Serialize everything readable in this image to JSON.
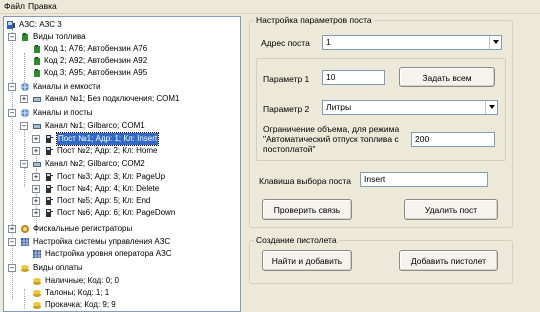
{
  "menu": {
    "file": "Файл",
    "edit": "Правка"
  },
  "tree": {
    "root": "АЗС: АЗС 3",
    "fuel_types": "Виды топлива",
    "fuel_items": [
      "Код 1; А76; Автобензин А76",
      "Код 2; А92; Автобензин А92",
      "Код 3; А95; Автобензин А95"
    ],
    "channels_tanks": "Каналы и емкости",
    "channel_1": "Канал №1; Без подключения; COM1",
    "channels_posts": "Каналы и посты",
    "channel_gilbarco_1": "Канал №1; Gilbarco; COM1",
    "posts_1": [
      "Пост №1; Адр: 1; Кл: Insert",
      "Пост №2; Адр: 2; Кл: Home"
    ],
    "channel_gilbarco_2": "Канал №2; Gilbarco; COM2",
    "posts_2": [
      "Пост №3; Адр: 3; Кл: PageUp",
      "Пост №4; Адр: 4; Кл: Delete",
      "Пост №5; Адр: 5; Кл: End",
      "Пост №6; Адр: 6; Кл: PageDown"
    ],
    "fiscal": "Фискальные регистраторы",
    "system_setup": "Настройка системы управления АЗС",
    "operator_level": "Настройка уровня оператора АЗС",
    "payment_types": "Виды оплаты",
    "payments": [
      "Наличные; Код: 0; 0",
      "Талоны; Код: 1; 1",
      "Прокачка; Код: 9; 9"
    ]
  },
  "settings": {
    "group_title": "Настройка параметров поста",
    "address_label": "Адрес поста",
    "address_value": "1",
    "param1_label": "Параметр 1",
    "param1_value": "10",
    "set_all_button": "Задать всем",
    "param2_label": "Параметр 2",
    "param2_value": "Литры",
    "limit_label_line1": "Ограничение объема, для режима",
    "limit_label_line2": "\"Автоматический отпуск топлива с",
    "limit_label_line3": "постоплатой\"",
    "limit_value": "200",
    "key_label": "Клавиша выбора поста",
    "key_value": "Insert",
    "check_button": "Проверить связь",
    "delete_button": "Удалить пост"
  },
  "pistol": {
    "group_title": "Создание пистолета",
    "find_add_button": "Найти и добавить",
    "add_pistol_button": "Добавить пистолет"
  },
  "colors": {
    "selection": "#316ac5",
    "panel_bg": "#ece9d8",
    "fuel_icon": "#2e8b2e",
    "folder_icon": "#e8c030"
  }
}
